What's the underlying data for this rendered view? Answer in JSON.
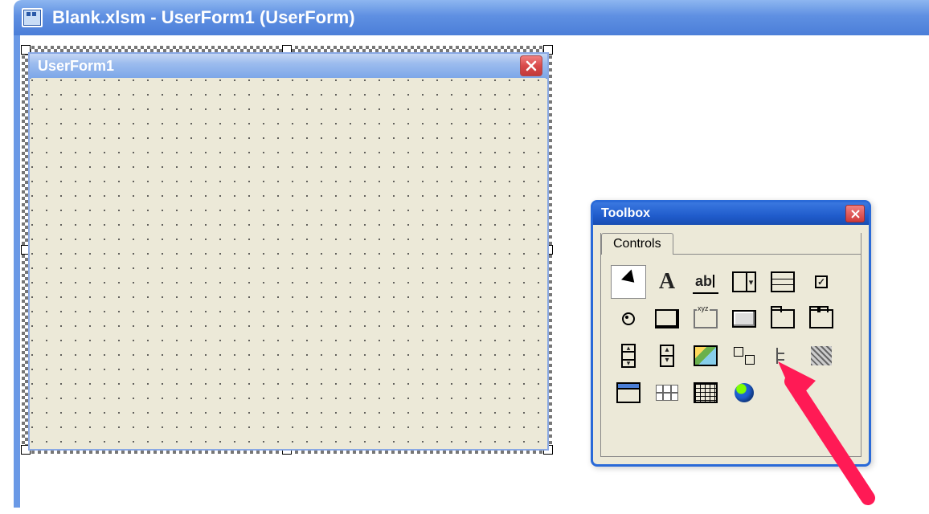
{
  "mdi": {
    "title": "Blank.xlsm - UserForm1 (UserForm)"
  },
  "userform": {
    "title": "UserForm1"
  },
  "toolbox": {
    "title": "Toolbox",
    "tab": "Controls",
    "tools": [
      {
        "name": "Select Objects",
        "icon": "pointer",
        "selected": true
      },
      {
        "name": "Label",
        "icon": "label"
      },
      {
        "name": "TextBox",
        "icon": "textbox"
      },
      {
        "name": "ComboBox",
        "icon": "combo"
      },
      {
        "name": "ListBox",
        "icon": "list"
      },
      {
        "name": "CheckBox",
        "icon": "check"
      },
      {
        "name": "OptionButton",
        "icon": "radio"
      },
      {
        "name": "ToggleButton",
        "icon": "toggle"
      },
      {
        "name": "Frame",
        "icon": "frame"
      },
      {
        "name": "CommandButton",
        "icon": "button"
      },
      {
        "name": "TabStrip",
        "icon": "tabstrip"
      },
      {
        "name": "MultiPage",
        "icon": "multipage"
      },
      {
        "name": "ScrollBar",
        "icon": "scroll"
      },
      {
        "name": "SpinButton",
        "icon": "spin"
      },
      {
        "name": "Image",
        "icon": "image"
      },
      {
        "name": "RefEdit",
        "icon": "ref"
      },
      {
        "name": "TreeView",
        "icon": "tree"
      },
      {
        "name": "ImageList",
        "icon": "hatch"
      },
      {
        "name": "Window",
        "icon": "window"
      },
      {
        "name": "DateTimePicker",
        "icon": "date"
      },
      {
        "name": "FlexGrid",
        "icon": "grid"
      },
      {
        "name": "WebBrowser",
        "icon": "web"
      }
    ]
  }
}
